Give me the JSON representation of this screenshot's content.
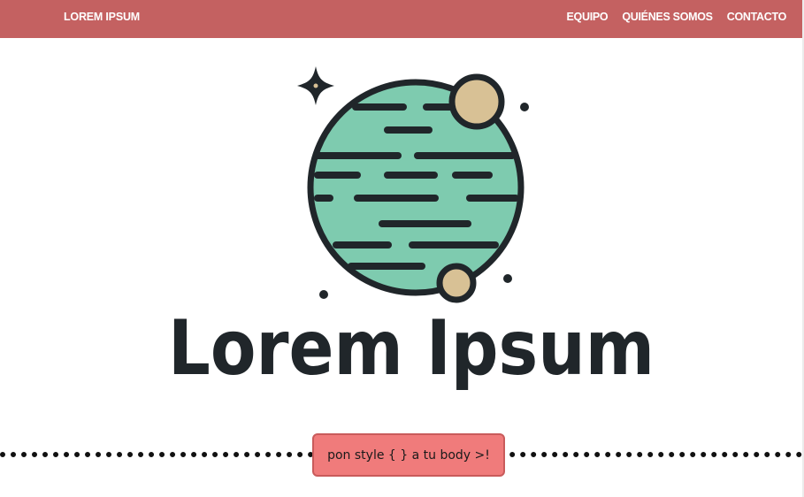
{
  "navbar": {
    "brand": "LOREM IPSUM",
    "links": [
      {
        "label": "EQUIPO"
      },
      {
        "label": "QUIÉNES SOMOS"
      },
      {
        "label": "CONTACTO"
      }
    ]
  },
  "hero": {
    "title": "Lorem Ipsum"
  },
  "action": {
    "button_label": "pon style { } a tu body >!"
  },
  "colors": {
    "navbar": "#c46161",
    "planet": "#7ecbaf",
    "moon": "#d8c195",
    "outline": "#20262a",
    "button": "#f07b7b"
  },
  "icons": {
    "logo": "planet-icon",
    "sparkle": "sparkle-icon"
  }
}
